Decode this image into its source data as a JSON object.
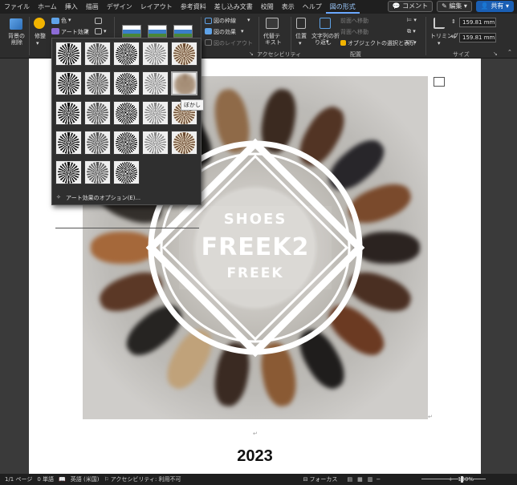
{
  "menu": {
    "tabs": [
      "ファイル",
      "ホーム",
      "挿入",
      "描画",
      "デザイン",
      "レイアウト",
      "参考資料",
      "差し込み文書",
      "校閲",
      "表示",
      "ヘルプ",
      "図の形式"
    ],
    "active_tab": "図の形式",
    "comment": "コメント",
    "edit": "編集",
    "share": "共有"
  },
  "ribbon": {
    "remove_bg": [
      "背景の",
      "削除"
    ],
    "correct": "修整",
    "color": "色",
    "art_effects": "アート効果",
    "border": "図の枠線",
    "effects": "図の効果",
    "layout": "図のレイアウト",
    "alt_text": [
      "代替テ",
      "キスト"
    ],
    "accessibility": "アクセシビリティ",
    "position": "位置",
    "wrap_text": [
      "文字列の折",
      "り返し"
    ],
    "bring_forward": "前面へ移動",
    "send_backward": "背面へ移動",
    "selection_pane": "オブジェクトの選択と表示",
    "arrange": "配置",
    "crop": "トリミング",
    "height": "159.81 mm",
    "width": "159.81 mm",
    "size": "サイズ"
  },
  "gallery": {
    "tooltip": "ぼかし",
    "option": "アート効果のオプション(E)..."
  },
  "logo": {
    "line1": "SHOES",
    "line2": "FREEK2",
    "line3": "FREEK"
  },
  "document": {
    "year": "2023"
  },
  "status": {
    "page": "1/1 ページ",
    "words": "0 単語",
    "lang": "英語 (米国)",
    "accessibility": "アクセシビリティ: 利用不可",
    "focus": "フォーカス",
    "zoom": "130%"
  },
  "colors": {
    "accent": "#6aa8ff",
    "share": "#1a5fb4"
  }
}
